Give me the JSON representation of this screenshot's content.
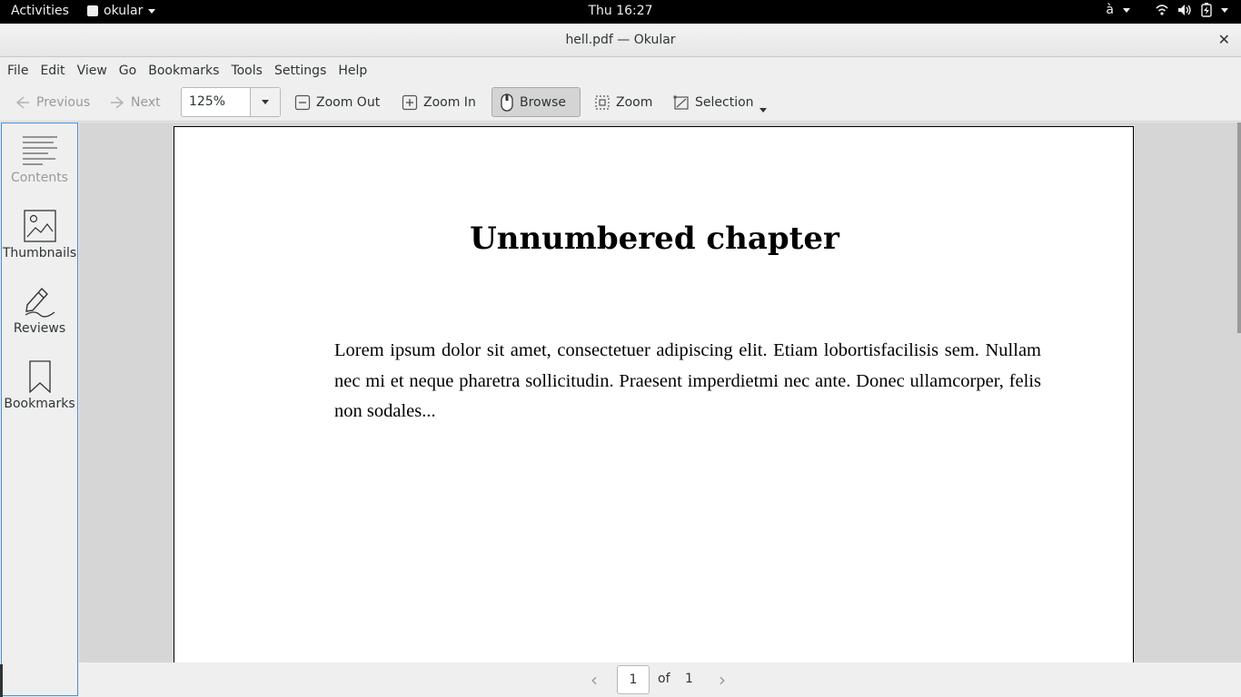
{
  "topbar": {
    "activities": "Activities",
    "app_name": "okular",
    "clock": "Thu 16:27",
    "keyboard_indicator": "à"
  },
  "window": {
    "title": "hell.pdf — Okular"
  },
  "menubar": {
    "items": [
      "File",
      "Edit",
      "View",
      "Go",
      "Bookmarks",
      "Tools",
      "Settings",
      "Help"
    ]
  },
  "toolbar": {
    "previous": "Previous",
    "next": "Next",
    "zoom_value": "125%",
    "zoom_out": "Zoom Out",
    "zoom_in": "Zoom In",
    "browse": "Browse",
    "zoom": "Zoom",
    "selection": "Selection"
  },
  "sidebar": {
    "items": [
      {
        "label": "Contents",
        "icon": "contents-icon"
      },
      {
        "label": "Thumbnails",
        "icon": "thumbnails-icon"
      },
      {
        "label": "Reviews",
        "icon": "reviews-icon"
      },
      {
        "label": "Bookmarks",
        "icon": "bookmarks-icon"
      }
    ]
  },
  "document": {
    "heading": "Unnumbered chapter",
    "body": "Lorem ipsum dolor sit amet, consectetuer adipiscing elit. Etiam lobortisfacilisis sem. Nullam nec mi et neque pharetra sollicitudin. Praesent imperdietmi nec ante. Donec ullamcorper, felis non sodales..."
  },
  "pagenav": {
    "current_page": "1",
    "of_label": "of",
    "total_pages": "1"
  },
  "colors": {
    "accent": "#4a90d9",
    "topbar": "#000000"
  }
}
